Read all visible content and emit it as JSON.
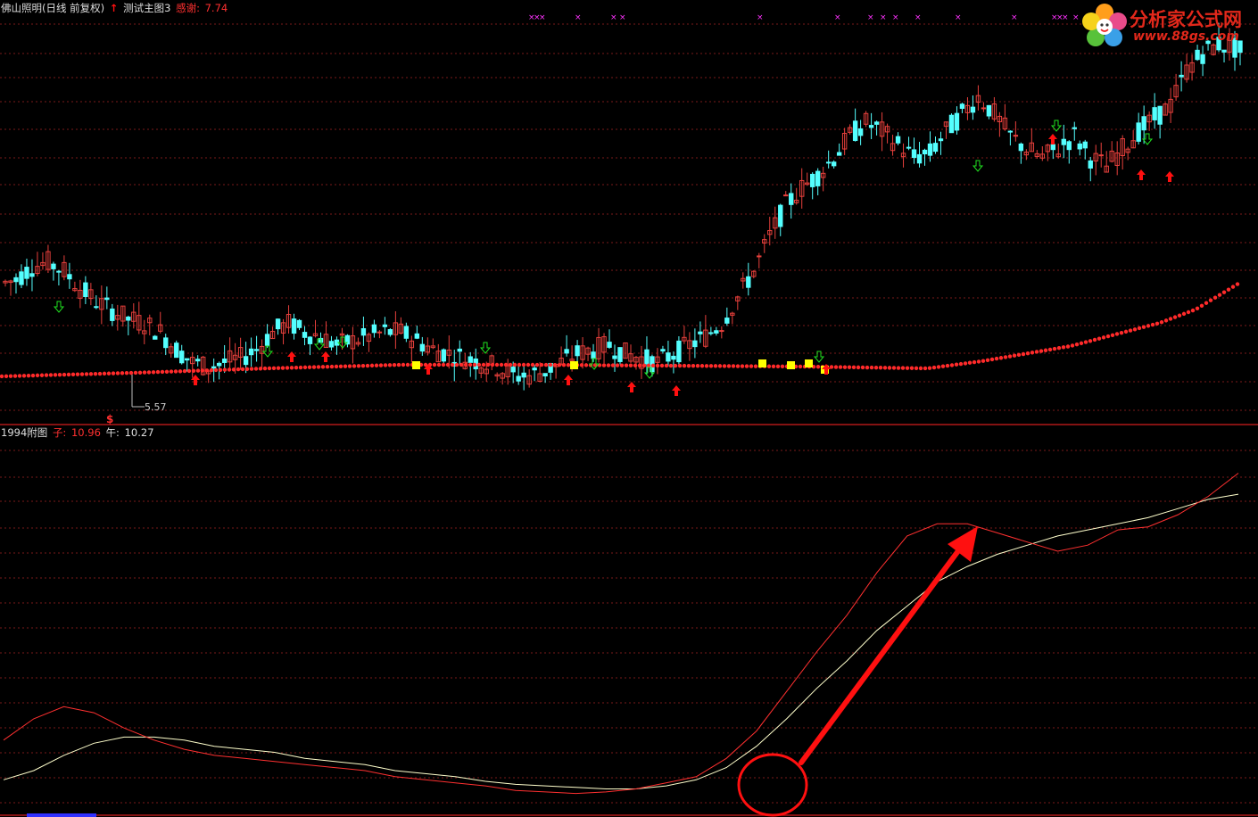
{
  "main_header": {
    "stock": "佛山照明(日线 前复权)",
    "indicator_arrow": "↑",
    "indicator_name": "测试主图3",
    "thanks_label": "感谢:",
    "thanks_value": "7.74"
  },
  "price_annotation": {
    "low_label": "5.57",
    "signal_char": "$"
  },
  "sub_header": {
    "name": "1994附图",
    "zi_label": "子:",
    "zi_value": "10.96",
    "wu_label": "午:",
    "wu_value": "10.27"
  },
  "logo": {
    "title": "分析家公式网",
    "url": "www.88gs.com"
  },
  "colors": {
    "up": "#e8403c",
    "down": "#54ffff",
    "grid": "#7a1a1a",
    "ma": "#ff2a2a",
    "zi_line": "#ff3030",
    "wu_line": "#ffffcc",
    "marker_magenta": "#ff33ff",
    "buy_arrow": "#ff1010",
    "sell_arrow": "#20e020",
    "box": "#ffff00"
  },
  "icons": [
    "up-arrow-icon",
    "down-arrow-icon",
    "cross-marker-icon",
    "flower-logo-icon"
  ],
  "chart_data": [
    {
      "type": "candlestick",
      "title": "佛山照明(日线 前复权)",
      "ylim": [
        5.0,
        14.0
      ],
      "series": [
        {
          "name": "测试主图3",
          "values": [
            8.2,
            8.5,
            8.6,
            8.4,
            8.0,
            7.7,
            7.5,
            7.3,
            7.2,
            7.0,
            6.6,
            6.3,
            6.2,
            6.3,
            6.4,
            6.6,
            7.0,
            7.2,
            7.0,
            6.9,
            6.7,
            6.8,
            6.9,
            7.0,
            7.0,
            6.8,
            6.6,
            6.5,
            6.4,
            6.3,
            6.2,
            6.0,
            6.0,
            6.1,
            6.3,
            6.5,
            6.6,
            6.7,
            6.5,
            6.4,
            6.3,
            6.5,
            6.7,
            6.9,
            7.2,
            7.8,
            8.4,
            9.2,
            9.9,
            10.3,
            10.6,
            11.0,
            11.5,
            11.8,
            11.6,
            11.3,
            11.0,
            11.1,
            11.6,
            12.0,
            12.4,
            12.0,
            11.5,
            11.2,
            11.0,
            11.2,
            11.5,
            11.0,
            10.8,
            11.2,
            11.6,
            11.9,
            12.2,
            13.0,
            13.4,
            13.6,
            13.5,
            13.3
          ]
        }
      ],
      "annotations": [
        "5.57",
        "$"
      ]
    },
    {
      "type": "line",
      "title": "1994附图",
      "ylim": [
        0,
        12
      ],
      "series": [
        {
          "name": "子",
          "last": 10.96,
          "values": [
            2.2,
            2.9,
            3.3,
            3.1,
            2.6,
            2.2,
            1.9,
            1.7,
            1.6,
            1.5,
            1.4,
            1.3,
            1.2,
            1.0,
            0.9,
            0.8,
            0.7,
            0.55,
            0.5,
            0.45,
            0.5,
            0.6,
            0.8,
            1.0,
            1.6,
            2.5,
            3.8,
            5.1,
            6.3,
            7.7,
            8.9,
            9.3,
            9.3,
            9.0,
            8.7,
            8.4,
            8.6,
            9.1,
            9.2,
            9.6,
            10.2,
            10.96
          ]
        },
        {
          "name": "午",
          "last": 10.27,
          "values": [
            0.9,
            1.2,
            1.7,
            2.1,
            2.3,
            2.3,
            2.2,
            2.0,
            1.9,
            1.8,
            1.6,
            1.5,
            1.4,
            1.2,
            1.1,
            1.0,
            0.85,
            0.75,
            0.7,
            0.65,
            0.6,
            0.6,
            0.7,
            0.9,
            1.3,
            2.0,
            2.9,
            3.9,
            4.8,
            5.8,
            6.6,
            7.4,
            7.9,
            8.3,
            8.6,
            8.9,
            9.1,
            9.3,
            9.5,
            9.8,
            10.1,
            10.27
          ]
        }
      ]
    }
  ]
}
